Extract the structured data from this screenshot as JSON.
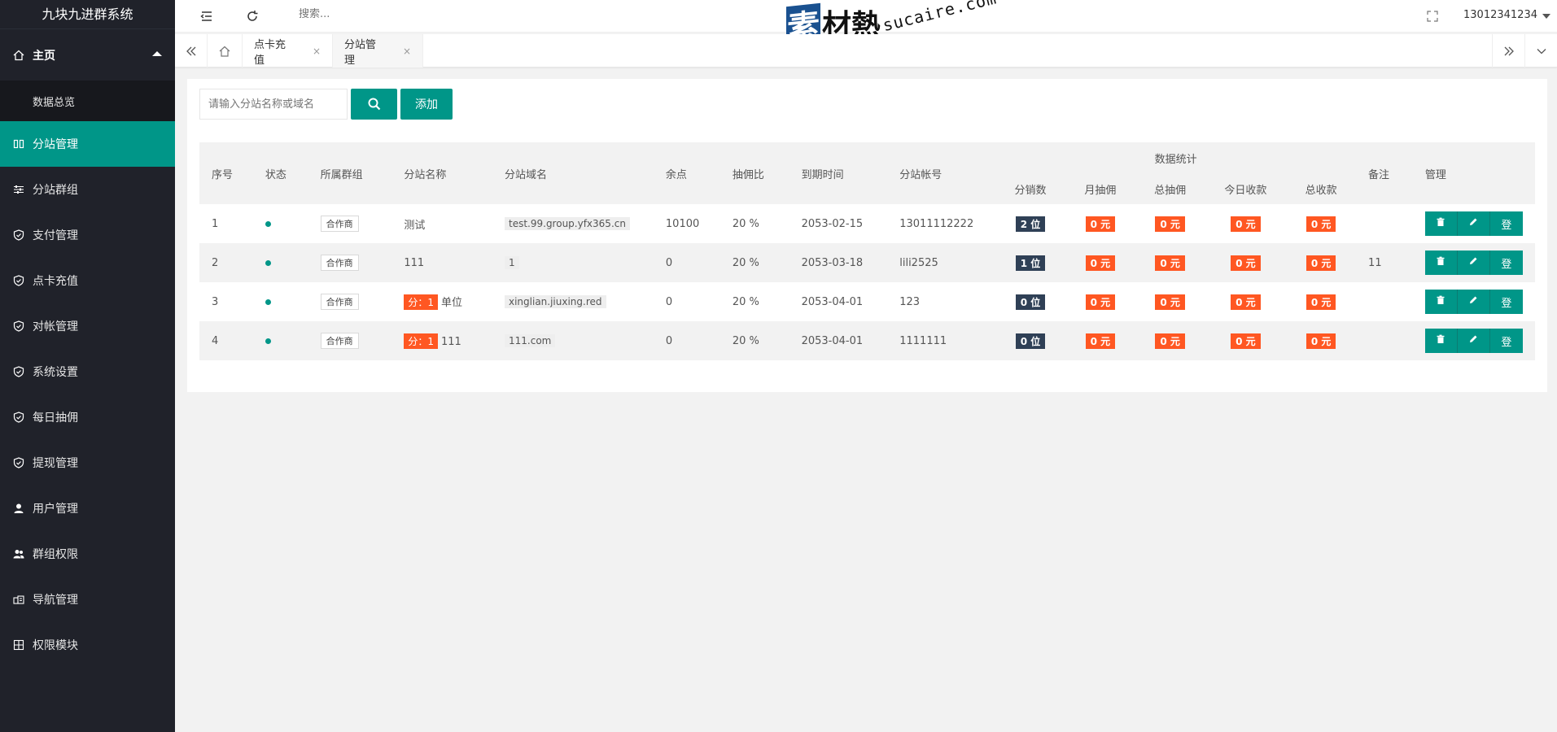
{
  "app": {
    "title": "九块九进群系统"
  },
  "sidebar": {
    "home_label": "主页",
    "sub_items": [
      {
        "label": "数据总览"
      }
    ],
    "items": [
      {
        "label": "分站管理",
        "icon": "columns-icon",
        "active": true
      },
      {
        "label": "分站群组",
        "icon": "sliders-icon"
      },
      {
        "label": "支付管理",
        "icon": "shield-check-icon"
      },
      {
        "label": "点卡充值",
        "icon": "shield-check-icon"
      },
      {
        "label": "对帐管理",
        "icon": "shield-check-icon"
      },
      {
        "label": "系统设置",
        "icon": "shield-check-icon"
      },
      {
        "label": "每日抽佣",
        "icon": "shield-check-icon"
      },
      {
        "label": "提现管理",
        "icon": "shield-check-icon"
      },
      {
        "label": "用户管理",
        "icon": "user-icon"
      },
      {
        "label": "群组权限",
        "icon": "users-icon"
      },
      {
        "label": "导航管理",
        "icon": "nav-icon"
      },
      {
        "label": "权限模块",
        "icon": "modules-icon"
      }
    ]
  },
  "header": {
    "search_placeholder": "搜索...",
    "user": "13012341234"
  },
  "watermark": {
    "mark": "素",
    "text": "材熱",
    "url": "sucaire.com"
  },
  "tabs": [
    {
      "label": "点卡充值",
      "close": "×"
    },
    {
      "label": "分站管理",
      "close": "×",
      "active": true
    }
  ],
  "toolbar": {
    "search_placeholder": "请输入分站名称或域名",
    "add_label": "添加"
  },
  "table": {
    "headers": {
      "index": "序号",
      "status": "状态",
      "group": "所属群组",
      "name": "分站名称",
      "domain": "分站域名",
      "balance": "余点",
      "ratio": "抽佣比",
      "expire": "到期时间",
      "account": "分站帐号",
      "stats": "数据统计",
      "remark": "备注",
      "manage": "管理",
      "stats_sub": [
        "分销数",
        "月抽佣",
        "总抽佣",
        "今日收款",
        "总收款"
      ]
    },
    "rows": [
      {
        "index": "1",
        "group": "合作商",
        "fen": "",
        "name": "测试",
        "domain": "test.99.group.yfx365.cn",
        "balance": "10100",
        "ratio": "20 %",
        "expire": "2053-02-15",
        "account": "13011112222",
        "dist": "2 位",
        "month": "0 元",
        "total_comm": "0 元",
        "today": "0 元",
        "total": "0 元",
        "remark": ""
      },
      {
        "index": "2",
        "group": "合作商",
        "fen": "",
        "name": "111",
        "domain": "1",
        "balance": "0",
        "ratio": "20 %",
        "expire": "2053-03-18",
        "account": "lili2525",
        "dist": "1 位",
        "month": "0 元",
        "total_comm": "0 元",
        "today": "0 元",
        "total": "0 元",
        "remark": "11"
      },
      {
        "index": "3",
        "group": "合作商",
        "fen": "分：1",
        "name": "单位",
        "domain": "xinglian.jiuxing.red",
        "balance": "0",
        "ratio": "20 %",
        "expire": "2053-04-01",
        "account": "123",
        "dist": "0 位",
        "month": "0 元",
        "total_comm": "0 元",
        "today": "0 元",
        "total": "0 元",
        "remark": ""
      },
      {
        "index": "4",
        "group": "合作商",
        "fen": "分：1",
        "name": "111",
        "domain": "111.com",
        "balance": "0",
        "ratio": "20 %",
        "expire": "2053-04-01",
        "account": "1111111",
        "dist": "0 位",
        "month": "0 元",
        "total_comm": "0 元",
        "today": "0 元",
        "total": "0 元",
        "remark": ""
      }
    ],
    "op_login_label": "登"
  },
  "colors": {
    "accent": "#009688",
    "sidebar_bg": "#20222a",
    "orange": "#ff5722",
    "dark_badge": "#2f4056"
  }
}
